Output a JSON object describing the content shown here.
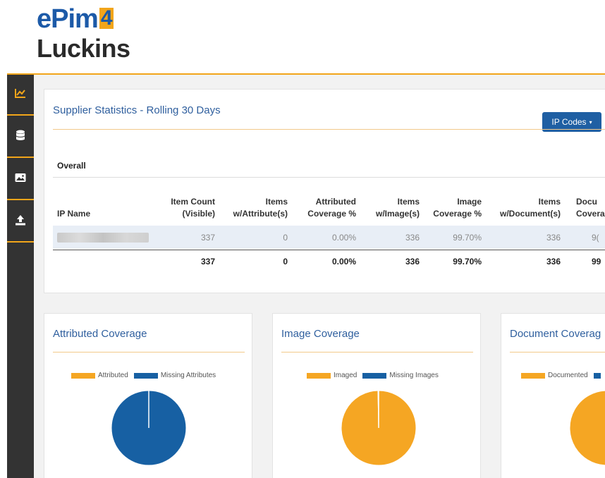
{
  "brand": {
    "line1": "ePim",
    "four": "4",
    "line2": "Luckins"
  },
  "colors": {
    "accent": "#f2a51a",
    "brand_blue": "#1c5aa8",
    "pie_orange": "#f5a623",
    "pie_blue": "#1760a3"
  },
  "sidebar": {
    "icons": [
      "chart-icon",
      "database-icon",
      "image-icon",
      "upload-icon"
    ]
  },
  "stats": {
    "title": "Supplier Statistics - Rolling 30 Days",
    "ip_button": "IP Codes",
    "section": "Overall",
    "headers": {
      "ip_name": "IP Name",
      "item_count_1": "Item Count",
      "item_count_2": "(Visible)",
      "items_attr_1": "Items",
      "items_attr_2": "w/Attribute(s)",
      "attr_cov_1": "Attributed",
      "attr_cov_2": "Coverage %",
      "items_img_1": "Items",
      "items_img_2": "w/Image(s)",
      "img_cov_1": "Image",
      "img_cov_2": "Coverage %",
      "items_doc_1": "Items",
      "items_doc_2": "w/Document(s)",
      "doc_cov_1": "Docu",
      "doc_cov_2": "Covera"
    },
    "row": {
      "item_count": "337",
      "items_attr": "0",
      "attr_cov": "0.00%",
      "items_img": "336",
      "img_cov": "99.70%",
      "items_doc": "336",
      "doc_cov": "9("
    },
    "total": {
      "item_count": "337",
      "items_attr": "0",
      "attr_cov": "0.00%",
      "items_img": "336",
      "img_cov": "99.70%",
      "items_doc": "336",
      "doc_cov": "99"
    }
  },
  "charts": {
    "attributed": {
      "title": "Attributed Coverage",
      "legend_a": "Attributed",
      "legend_b": "Missing Attributes"
    },
    "image": {
      "title": "Image Coverage",
      "legend_a": "Imaged",
      "legend_b": "Missing Images"
    },
    "document": {
      "title": "Document Coverag",
      "legend_a": "Documented"
    }
  },
  "chart_data": [
    {
      "type": "pie",
      "title": "Attributed Coverage",
      "categories": [
        "Attributed",
        "Missing Attributes"
      ],
      "values": [
        0,
        337
      ]
    },
    {
      "type": "pie",
      "title": "Image Coverage",
      "categories": [
        "Imaged",
        "Missing Images"
      ],
      "values": [
        336,
        1
      ]
    },
    {
      "type": "pie",
      "title": "Document Coverag",
      "categories": [
        "Documented"
      ],
      "values": [
        336,
        1
      ]
    }
  ]
}
